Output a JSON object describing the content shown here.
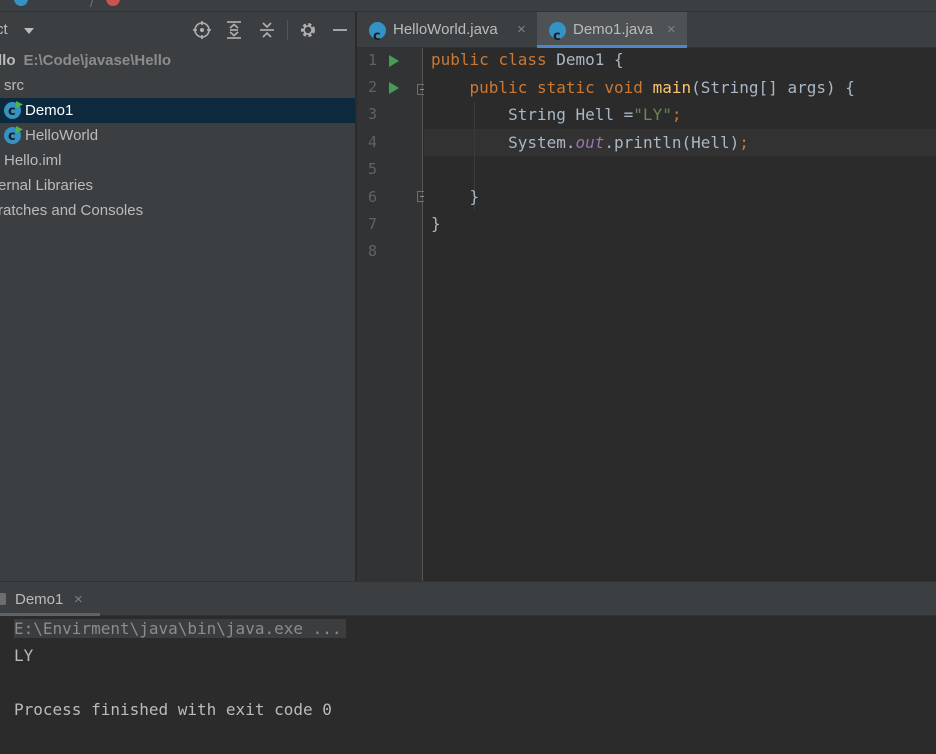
{
  "project_panel": {
    "title": "ct",
    "tree": [
      {
        "label": "llo",
        "path": "E:\\Code\\javase\\Hello"
      },
      {
        "label": "src"
      },
      {
        "label": "Demo1",
        "selected": true
      },
      {
        "label": "HelloWorld"
      },
      {
        "label": "Hello.iml"
      },
      {
        "label": "ernal Libraries"
      },
      {
        "label": "ratches and Consoles"
      }
    ],
    "header_icons": [
      "locate-icon",
      "expand-all-icon",
      "collapse-all-icon",
      "gear-icon",
      "hide-icon"
    ]
  },
  "editor": {
    "tabs": [
      {
        "label": "HelloWorld.java",
        "active": false
      },
      {
        "label": "Demo1.java",
        "active": true
      }
    ],
    "line_numbers": [
      "1",
      "2",
      "3",
      "4",
      "5",
      "6",
      "7",
      "8"
    ],
    "code": {
      "l1": {
        "kw1": "public",
        "kw2": "class",
        "name": "Demo1 {"
      },
      "l2": {
        "kw1": "public",
        "kw2": "static",
        "kw3": "void",
        "fn": "main",
        "rest": "(String[] args) {"
      },
      "l3": {
        "type": "String Hell =",
        "str": "\"LY\"",
        "semi": ";"
      },
      "l4": {
        "obj": "System.",
        "field": "out",
        "call": ".println(Hell)",
        "semi": ";"
      },
      "l6": {
        "text": "}"
      },
      "l7": {
        "text": "}"
      }
    }
  },
  "run_window": {
    "tab_label": "Demo1",
    "close": "×",
    "console": [
      "E:\\Envirment\\java\\bin\\java.exe ...",
      "LY",
      "",
      "Process finished with exit code 0"
    ]
  },
  "colors": {
    "keyword": "#cc7832",
    "method": "#ffc66d",
    "string": "#6a8759",
    "field": "#9876aa",
    "selection": "#0d293e",
    "accent": "#4a88c7"
  }
}
